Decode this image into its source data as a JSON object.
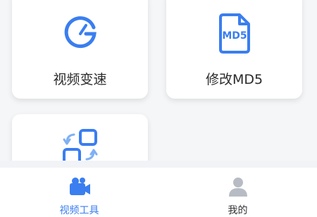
{
  "tools": [
    {
      "label": "视频变速",
      "icon": "speedometer-icon"
    },
    {
      "label": "修改MD5",
      "icon": "md5-file-icon"
    },
    {
      "label": "",
      "icon": "convert-swap-icon"
    }
  ],
  "md5_icon_text": "MD5",
  "tabbar": {
    "tabs": [
      {
        "label": "视频工具",
        "icon": "video-camera-icon",
        "active": true
      },
      {
        "label": "我的",
        "icon": "user-icon",
        "active": false
      }
    ]
  },
  "colors": {
    "accent": "#3a7ef0",
    "inactive": "#b7bcc4",
    "active_label": "#3a7ef0",
    "inactive_label": "#333333",
    "background": "#f5f6f8"
  }
}
